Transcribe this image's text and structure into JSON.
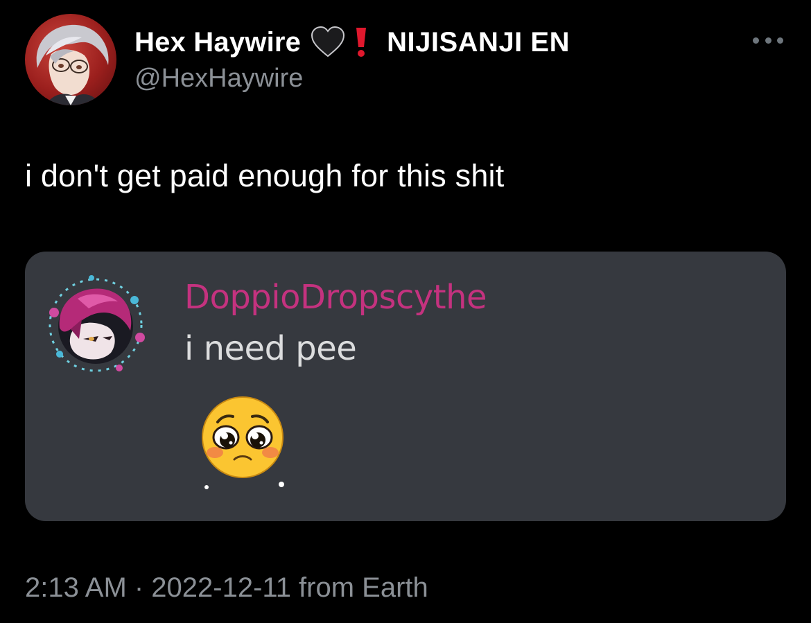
{
  "tweet": {
    "author": {
      "display_name": "Hex Haywire",
      "emoji_1": "black-heart-icon",
      "emoji_2": "red-exclamation-icon",
      "affiliation": "NIJISANJI EN",
      "handle": "@HexHaywire"
    },
    "text": "i don't get paid enough for this shit",
    "timestamp": "2:13 AM · 2022-12-11 from Earth",
    "more_icon": "more-horizontal-icon"
  },
  "media": {
    "discord_message": {
      "username": "DoppioDropscythe",
      "username_color": "#c4327f",
      "message": "i need pee",
      "emoji": "pleading-face-emoji"
    },
    "background_color": "#36393f"
  },
  "colors": {
    "background": "#000000",
    "secondary_text": "#8b9096",
    "accent_red": "#e0182d"
  }
}
